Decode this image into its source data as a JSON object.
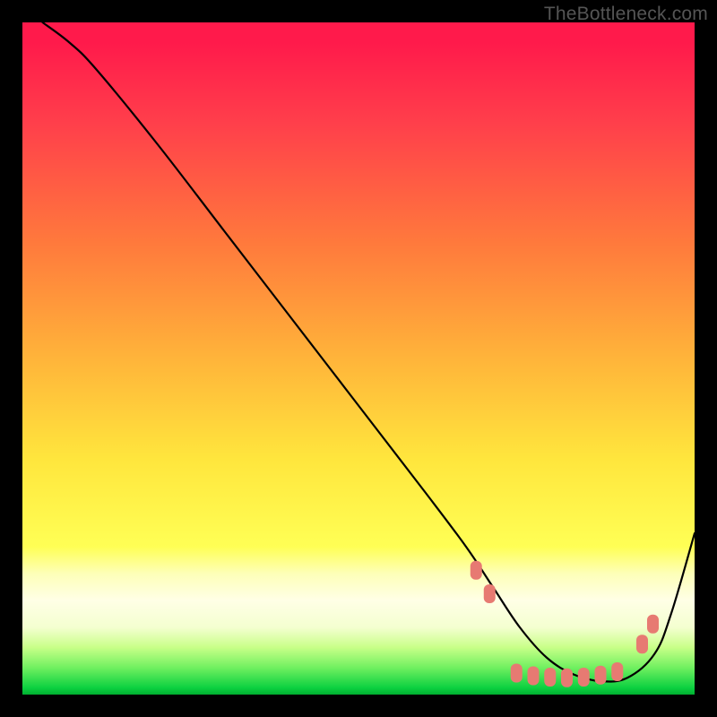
{
  "watermark": "TheBottleneck.com",
  "chart_data": {
    "type": "line",
    "title": "",
    "xlabel": "",
    "ylabel": "",
    "xlim": [
      0,
      100
    ],
    "ylim": [
      0,
      100
    ],
    "grid": false,
    "legend": false,
    "series": [
      {
        "name": "bottleneck-curve",
        "color": "#000000",
        "x": [
          3,
          7,
          11,
          20,
          30,
          40,
          50,
          60,
          66,
          70,
          74,
          78,
          82,
          86,
          90,
          94,
          96.5,
          100
        ],
        "y": [
          100,
          97,
          93,
          82,
          69,
          56,
          43,
          30,
          22,
          16,
          10,
          5.5,
          3,
          2,
          2.5,
          6,
          12,
          24
        ]
      }
    ],
    "markers": {
      "name": "highlight-markers",
      "color": "#e77a72",
      "shape": "rounded-rect",
      "points": [
        {
          "x": 67.5,
          "y": 18.5
        },
        {
          "x": 69.5,
          "y": 15
        },
        {
          "x": 73.5,
          "y": 3.2
        },
        {
          "x": 76,
          "y": 2.8
        },
        {
          "x": 78.5,
          "y": 2.6
        },
        {
          "x": 81,
          "y": 2.5
        },
        {
          "x": 83.5,
          "y": 2.6
        },
        {
          "x": 86,
          "y": 2.9
        },
        {
          "x": 88.5,
          "y": 3.4
        },
        {
          "x": 92.2,
          "y": 7.5
        },
        {
          "x": 93.8,
          "y": 10.5
        }
      ]
    }
  }
}
